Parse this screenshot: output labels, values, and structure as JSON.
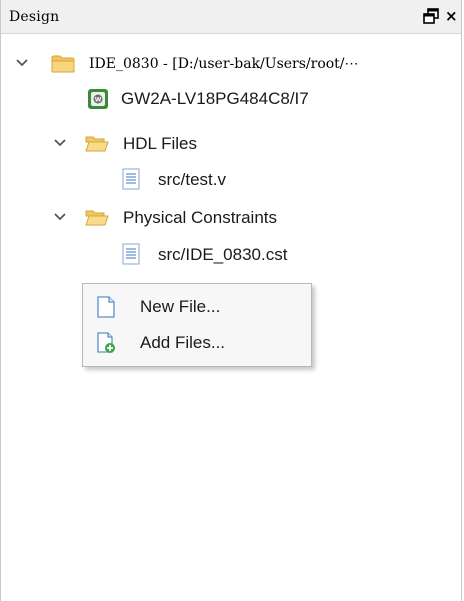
{
  "panel": {
    "title": "Design",
    "float_icon": "float-window-icon",
    "close_glyph": "×"
  },
  "tree": {
    "project": {
      "label": "IDE_0830 - [D:/user-bak/Users/root/⋯",
      "icon": "project-folder-icon",
      "expanded": true
    },
    "device": {
      "label": "GW2A-LV18PG484C8/I7",
      "icon": "chip-icon"
    },
    "hdl_folder": {
      "label": "HDL Files",
      "icon": "folder-open-icon",
      "expanded": true
    },
    "hdl_file": {
      "label": "src/test.v",
      "icon": "file-text-icon"
    },
    "constraints_folder": {
      "label": "Physical Constraints",
      "icon": "folder-open-icon",
      "expanded": true
    },
    "constraints_file": {
      "label": "src/IDE_0830.cst",
      "icon": "file-text-icon"
    }
  },
  "context_menu": {
    "items": [
      {
        "label": "New File...",
        "icon": "new-file-icon"
      },
      {
        "label": "Add Files...",
        "icon": "add-file-icon"
      }
    ]
  },
  "colors": {
    "folder_yellow": "#f5d372",
    "chip_green": "#3a8a3a",
    "file_blue": "#5b8fc9",
    "add_green": "#3aa74a"
  }
}
